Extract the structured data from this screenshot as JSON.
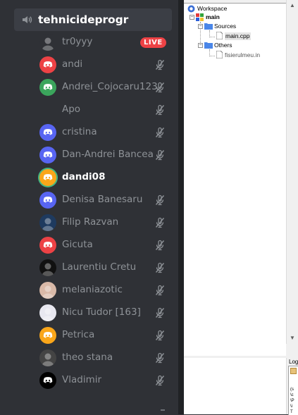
{
  "voice_channel": {
    "name": "tehnicideprogr",
    "icon": "speaker-icon"
  },
  "users": [
    {
      "name": "tr0yyy",
      "live_badge": "LIVE",
      "avatar_color": "#2f3136",
      "avatar_style": "dark-photo"
    },
    {
      "name": "andi",
      "avatar_color": "#ed4245",
      "avatar_style": "discord"
    },
    {
      "name": "Andrei_Cojocaru123",
      "avatar_color": "#3ba55c",
      "avatar_style": "discord"
    },
    {
      "name": "Apo",
      "avatar_color": "#2f3136",
      "avatar_style": "none"
    },
    {
      "name": "cristina",
      "avatar_color": "#5865f2",
      "avatar_style": "discord"
    },
    {
      "name": "Dan-Andrei Bancea",
      "avatar_color": "#5865f2",
      "avatar_style": "discord"
    },
    {
      "name": "dandi08",
      "avatar_color": "#faa61a",
      "avatar_style": "discord",
      "speaking": true
    },
    {
      "name": "Denisa Banesaru",
      "avatar_color": "#5865f2",
      "avatar_style": "discord"
    },
    {
      "name": "Filip Razvan",
      "avatar_color": "#1e3a5f",
      "avatar_style": "photo"
    },
    {
      "name": "Gicuta",
      "avatar_color": "#ed4245",
      "avatar_style": "discord"
    },
    {
      "name": "Laurentiu Cretu",
      "avatar_color": "#111111",
      "avatar_style": "photo"
    },
    {
      "name": "melaniazotic",
      "avatar_color": "#d9b9a8",
      "avatar_style": "photo"
    },
    {
      "name": "Nicu Tudor [163]",
      "avatar_color": "#e8e8f0",
      "avatar_style": "photo"
    },
    {
      "name": "Petrica",
      "avatar_color": "#faa61a",
      "avatar_style": "discord"
    },
    {
      "name": "theo stana",
      "avatar_color": "#444444",
      "avatar_style": "photo"
    },
    {
      "name": "Vladimir",
      "avatar_color": "#000000",
      "avatar_style": "discord"
    }
  ],
  "muted_icon": "microphone-muted-icon",
  "ide": {
    "workspace": "Workspace",
    "project": "main",
    "sources_folder": "Sources",
    "source_file": "main.cpp",
    "others_folder": "Others",
    "other_file": "fisierulmeu.in",
    "logs_title": "Log",
    "log_lines": [
      "(s",
      "\\c",
      "\\P",
      "\\i",
      "T"
    ]
  }
}
